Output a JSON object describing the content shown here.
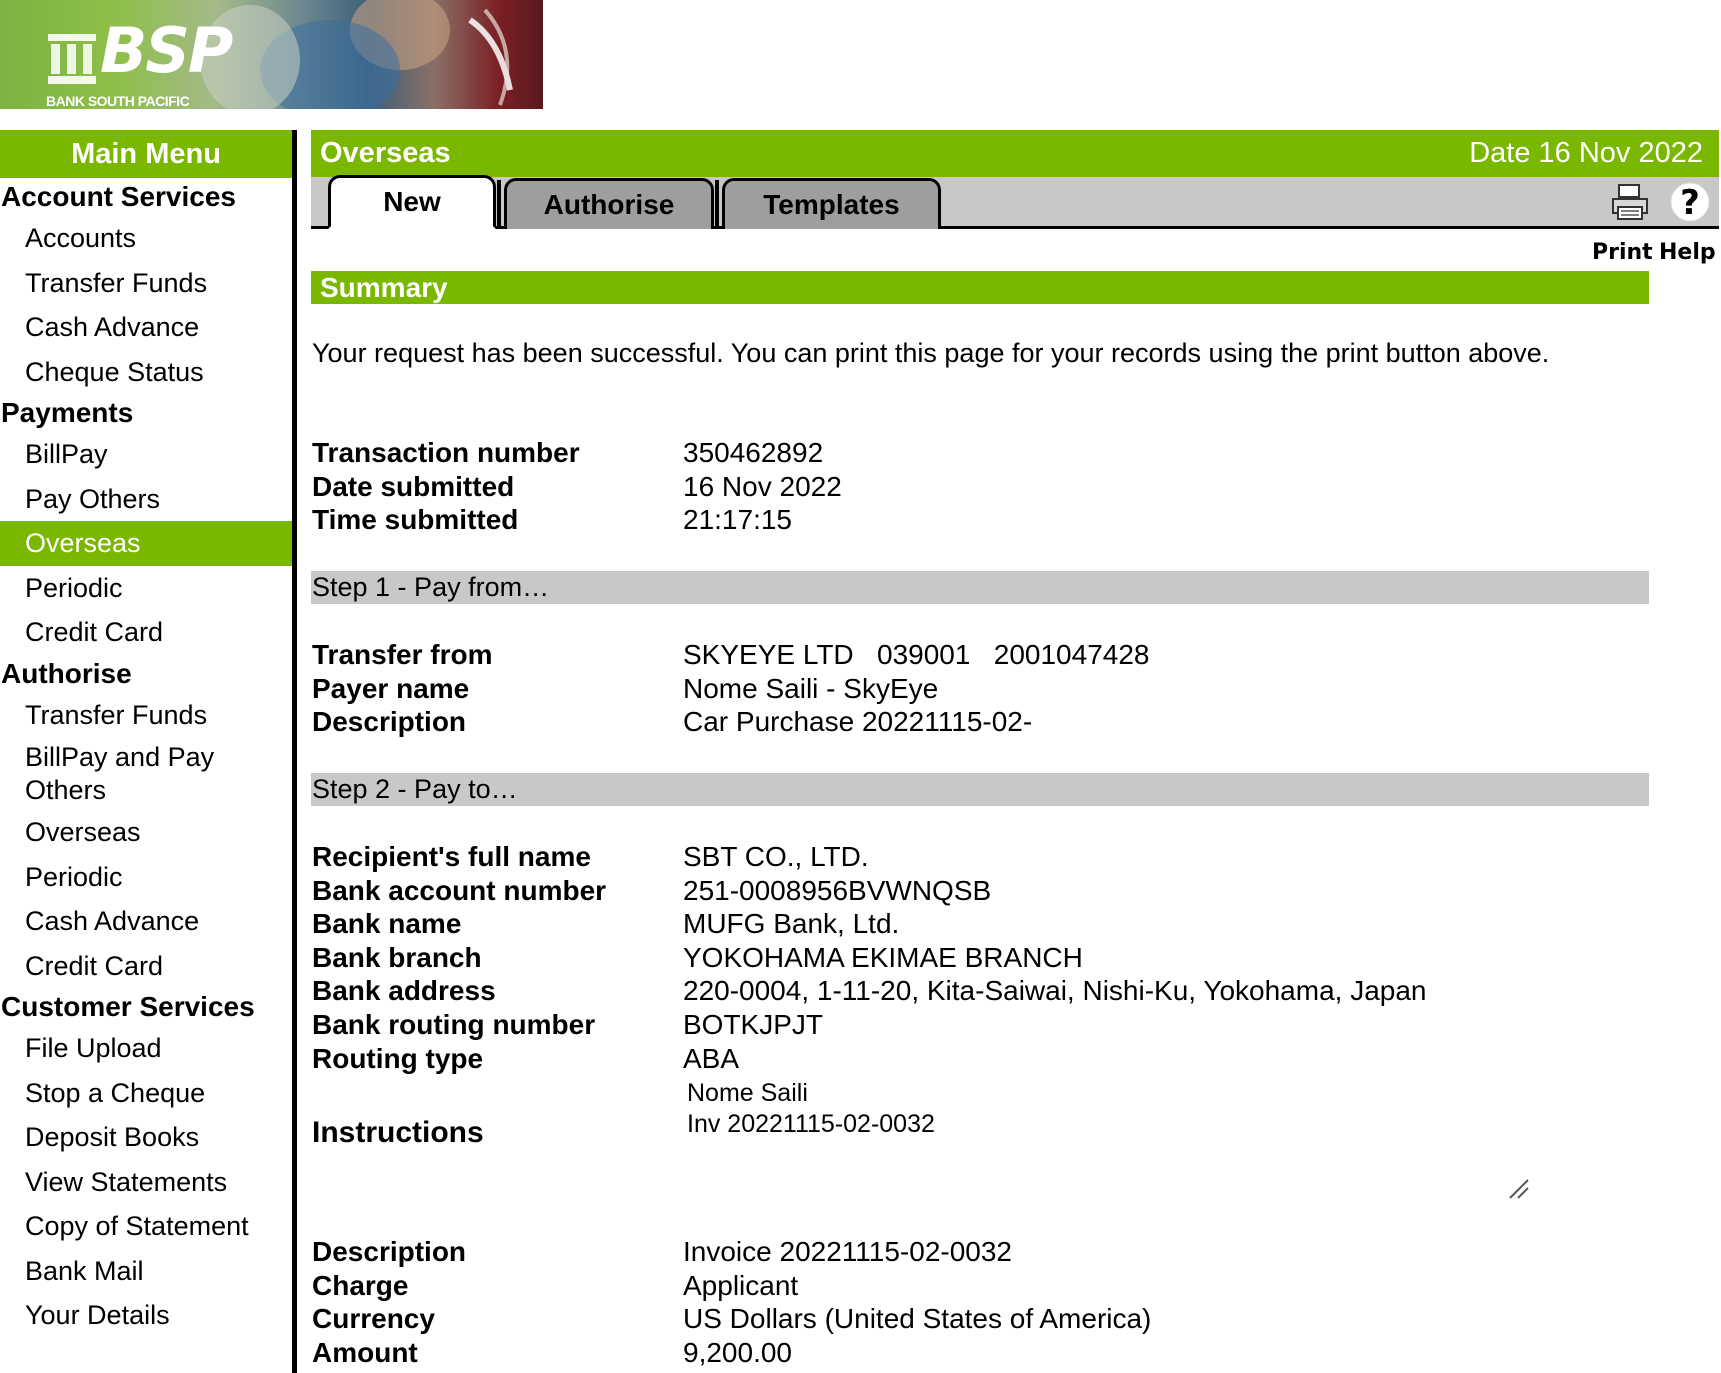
{
  "brand": {
    "logo_text": "BSP",
    "logo_subtext": "BANK SOUTH PACIFIC"
  },
  "menu": {
    "header": "Main Menu",
    "sections": [
      {
        "title": "Account Services",
        "items": [
          "Accounts",
          "Transfer Funds",
          "Cash Advance",
          "Cheque Status"
        ]
      },
      {
        "title": "Payments",
        "items": [
          "BillPay",
          "Pay Others",
          "Overseas",
          "Periodic",
          "Credit Card"
        ]
      },
      {
        "title": "Authorise",
        "items": [
          "Transfer Funds",
          "BillPay and Pay Others",
          "Overseas",
          "Periodic",
          "Cash Advance",
          "Credit Card"
        ]
      },
      {
        "title": "Customer Services",
        "items": [
          "File Upload",
          "Stop a Cheque",
          "Deposit Books",
          "View Statements",
          "Copy of Statement",
          "Bank Mail",
          "Your Details"
        ]
      }
    ],
    "active_item": "Overseas"
  },
  "header": {
    "title": "Overseas",
    "date": "Date 16 Nov 2022"
  },
  "tabs": [
    {
      "label": "New",
      "active": true
    },
    {
      "label": "Authorise",
      "active": false
    },
    {
      "label": "Templates",
      "active": false
    }
  ],
  "tools": {
    "print_label": "Print",
    "help_label": "Help",
    "print_icon": "printer-icon",
    "help_icon": "question-mark-icon"
  },
  "summary": {
    "title": "Summary",
    "message": "Your request has been successful. You can print this page for your records using the print button above.",
    "rows": [
      {
        "label": "Transaction number",
        "value": "350462892"
      },
      {
        "label": "Date submitted",
        "value": "16 Nov 2022"
      },
      {
        "label": "Time submitted",
        "value": "21:17:15"
      }
    ]
  },
  "step1": {
    "title": "Step 1 - Pay from…",
    "rows": [
      {
        "label": "Transfer from",
        "value": "SKYEYE LTD   039001   2001047428"
      },
      {
        "label": "Payer name",
        "value": "Nome Saili - SkyEye"
      },
      {
        "label": "Description",
        "value": "Car Purchase 20221115-02-"
      }
    ]
  },
  "step2": {
    "title": "Step 2 - Pay to…",
    "rows": [
      {
        "label": "Recipient's full name",
        "value": "SBT CO., LTD."
      },
      {
        "label": "Bank account number",
        "value": "251-0008956BVWNQSB"
      },
      {
        "label": "Bank name",
        "value": "MUFG Bank, Ltd."
      },
      {
        "label": "Bank branch",
        "value": "YOKOHAMA EKIMAE BRANCH"
      },
      {
        "label": "Bank address",
        "value": "220-0004, 1-11-20, Kita-Saiwai, Nishi-Ku, Yokohama, Japan"
      },
      {
        "label": "Bank routing number",
        "value": "BOTKJPJT"
      },
      {
        "label": "Routing type",
        "value": "ABA"
      }
    ],
    "instructions_label": "Instructions",
    "instructions_lines": [
      "Nome Saili",
      "Inv 20221115-02-0032"
    ],
    "payment_rows": [
      {
        "label": "Description",
        "value": "Invoice 20221115-02-0032"
      },
      {
        "label": "Charge",
        "value": "Applicant"
      },
      {
        "label": "Currency",
        "value": "US Dollars (United States of America)"
      },
      {
        "label": "Amount",
        "value": "9,200.00"
      }
    ]
  },
  "colors": {
    "brand_green": "#7ab800",
    "tab_bar_grey": "#c8c8c8",
    "inactive_tab_grey": "#9e9e9e"
  }
}
